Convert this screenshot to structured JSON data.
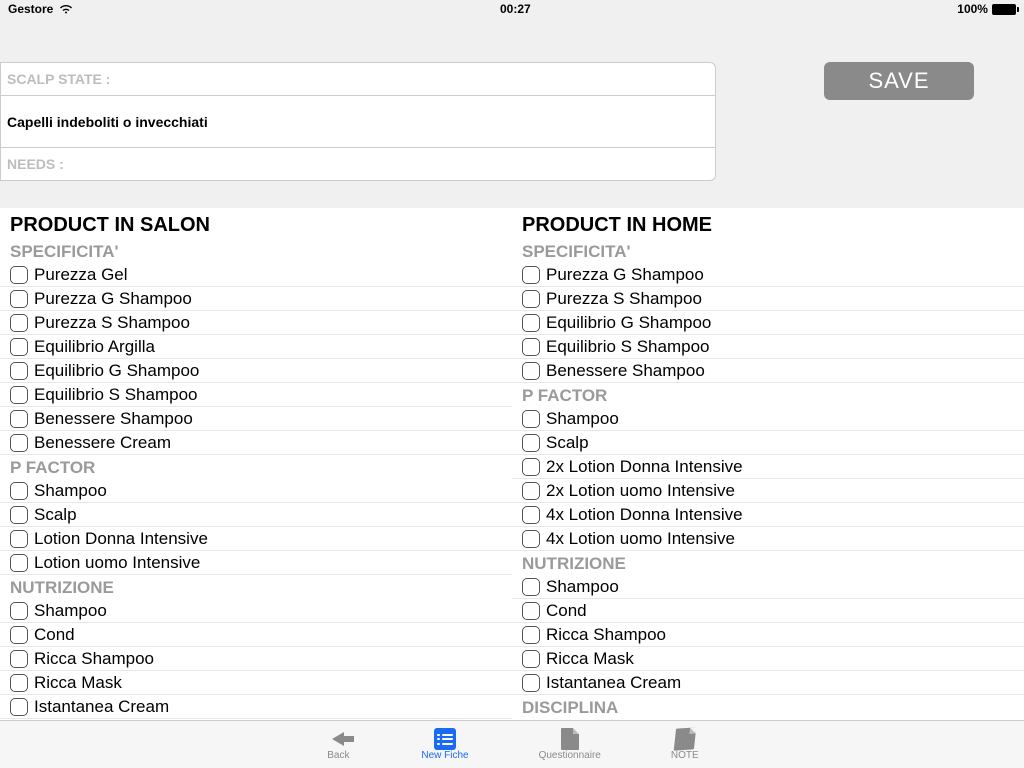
{
  "status": {
    "carrier": "Gestore",
    "time": "00:27",
    "battery": "100%"
  },
  "save_label": "SAVE",
  "fields": {
    "scalp_state_label": "SCALP STATE :",
    "scalp_value": "Capelli indeboliti o invecchiati",
    "needs_label": "NEEDS :"
  },
  "columns": {
    "salon": {
      "title": "PRODUCT IN SALON",
      "groups": [
        {
          "header": "SPECIFICITA'",
          "items": [
            "Purezza Gel",
            "Purezza G Shampoo",
            "Purezza S Shampoo",
            "Equilibrio Argilla",
            "Equilibrio G Shampoo",
            "Equilibrio S Shampoo",
            "Benessere Shampoo",
            "Benessere Cream"
          ]
        },
        {
          "header": "P FACTOR",
          "items": [
            "Shampoo",
            "Scalp",
            "Lotion Donna Intensive",
            "Lotion uomo Intensive"
          ]
        },
        {
          "header": "NUTRIZIONE",
          "items": [
            "Shampoo",
            "Cond",
            "Ricca Shampoo",
            "Ricca Mask",
            "Istantanea Cream"
          ]
        }
      ]
    },
    "home": {
      "title": "PRODUCT IN HOME",
      "groups": [
        {
          "header": "SPECIFICITA'",
          "items": [
            "Purezza G Shampoo",
            "Purezza S Shampoo",
            "Equilibrio G Shampoo",
            "Equilibrio S Shampoo",
            "Benessere Shampoo"
          ]
        },
        {
          "header": "P FACTOR",
          "items": [
            "Shampoo",
            "Scalp",
            "2x Lotion Donna Intensive",
            "2x Lotion uomo Intensive",
            "4x Lotion Donna Intensive",
            "4x Lotion uomo Intensive"
          ]
        },
        {
          "header": "NUTRIZIONE",
          "items": [
            "Shampoo",
            "Cond",
            "Ricca Shampoo",
            "Ricca Mask",
            "Istantanea Cream"
          ]
        },
        {
          "header": "DISCIPLINA",
          "items": []
        }
      ]
    }
  },
  "tabs": {
    "back": "Back",
    "new_fiche": "New Fiche",
    "questionnaire": "Questionnaire",
    "note": "NOTE"
  }
}
